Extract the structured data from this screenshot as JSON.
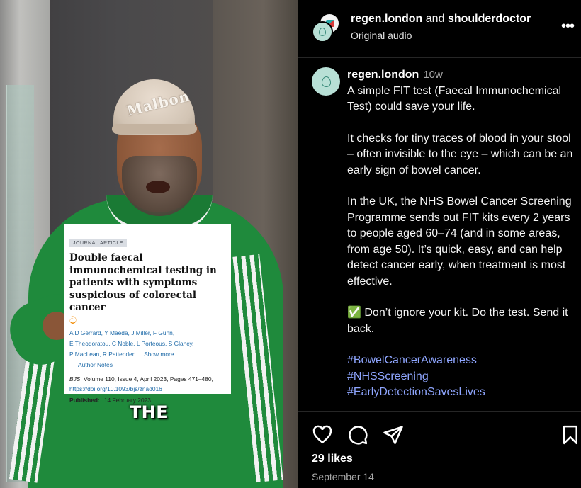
{
  "video": {
    "cap_logo": "Malbon",
    "paper": {
      "tag": "JOURNAL ARTICLE",
      "title": "Double faecal immunochemical testing in patients with symptoms suspicious of colorectal cancer",
      "open_access_symbol": "ට",
      "authors_line1": "A D Gerrard, Y Maeda, J Miller, F Gunn,",
      "authors_line2": "E Theodoratou, C Noble, L Porteous, S Glancy,",
      "authors_line3": "P MacLean, R Pattenden ...",
      "show_more": "Show more",
      "author_notes": "Author Notes",
      "journal": "BJS",
      "citation": ", Volume 110, Issue 4, April 2023, Pages 471–480,",
      "doi": "https://doi.org/10.1093/bjs/znad016",
      "published_label": "Published:",
      "published_date": "14 February 2023"
    },
    "caption_word": "THE"
  },
  "post": {
    "header": {
      "user1": "regen.london",
      "and": "and",
      "user2": "shoulderdoctor",
      "audio": "Original audio",
      "more_icon": "more-horizontal-icon"
    },
    "caption": {
      "username": "regen.london",
      "time": "10w",
      "para1": "A simple FIT test (Faecal Immunochemical Test) could save your life.",
      "para2": "It checks for tiny traces of blood in your stool – often invisible to the eye – which can be an early sign of bowel cancer.",
      "para3": "In the UK, the NHS Bowel Cancer Screening Programme sends out FIT kits every 2 years to people aged 60–74 (and in some areas, from age 50). It’s quick, easy, and can help detect cancer early, when treatment is most effective.",
      "para4": "✅ Don’t ignore your kit. Do the test. Send it back.",
      "hashtags": [
        "#BowelCancerAwareness",
        "#NHSScreening",
        "#EarlyDetectionSavesLives"
      ]
    },
    "likes": "29 likes",
    "date": "September 14"
  }
}
